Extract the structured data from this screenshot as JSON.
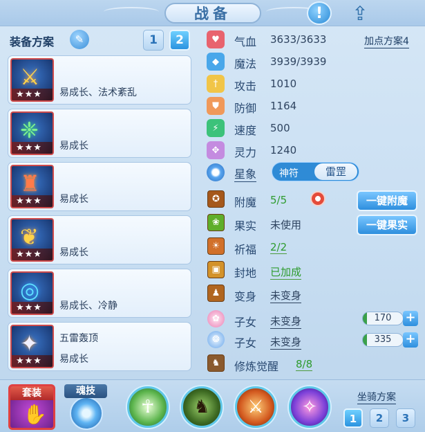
{
  "header": {
    "title": "战备"
  },
  "left": {
    "plan_label": "装备方案",
    "pages": [
      "1",
      "2"
    ],
    "equipment": [
      {
        "line1": "",
        "line2": "易成长、法术紊乱",
        "stars": "★★★"
      },
      {
        "line1": "",
        "line2": "易成长",
        "stars": "★★★"
      },
      {
        "line1": "",
        "line2": "易成长",
        "stars": "★★★"
      },
      {
        "line1": "",
        "line2": "易成长",
        "stars": "★★★"
      },
      {
        "line1": "",
        "line2": "易成长、冷静",
        "stars": "★★★"
      },
      {
        "line1": "五雷轰顶",
        "line2": "易成长",
        "stars": "★★★"
      }
    ]
  },
  "stats": {
    "add_plan": "加点方案4",
    "items": [
      {
        "name": "气血",
        "value": "3633/3633"
      },
      {
        "name": "魔法",
        "value": "3939/3939"
      },
      {
        "name": "攻击",
        "value": "1010"
      },
      {
        "name": "防御",
        "value": "1164"
      },
      {
        "name": "速度",
        "value": "500"
      },
      {
        "name": "灵力",
        "value": "1240"
      }
    ],
    "star_label": "星象",
    "star_options": [
      "神符",
      "雷罡"
    ]
  },
  "rows": {
    "enchant": {
      "name": "附魔",
      "value": "5/5"
    },
    "fruit": {
      "name": "果实",
      "value": "未使用"
    },
    "bless": {
      "name": "祈福",
      "value": "2/2"
    },
    "seal": {
      "name": "封地",
      "value": "已加成"
    },
    "transform": {
      "name": "变身",
      "value": "未变身"
    },
    "child1": {
      "name": "子女",
      "value": "未变身",
      "num": "170"
    },
    "child2": {
      "name": "子女",
      "value": "未变身",
      "num": "335"
    },
    "awaken": {
      "name": "修炼觉醒",
      "value": "8/8"
    }
  },
  "buttons": {
    "one_key_enchant": "一键附魔",
    "one_key_fruit": "一键果实"
  },
  "bottom": {
    "suit_label": "套装",
    "soul_label": "魂技",
    "mount_label": "坐骑方案",
    "mount_pages": [
      "1",
      "2",
      "3"
    ]
  }
}
